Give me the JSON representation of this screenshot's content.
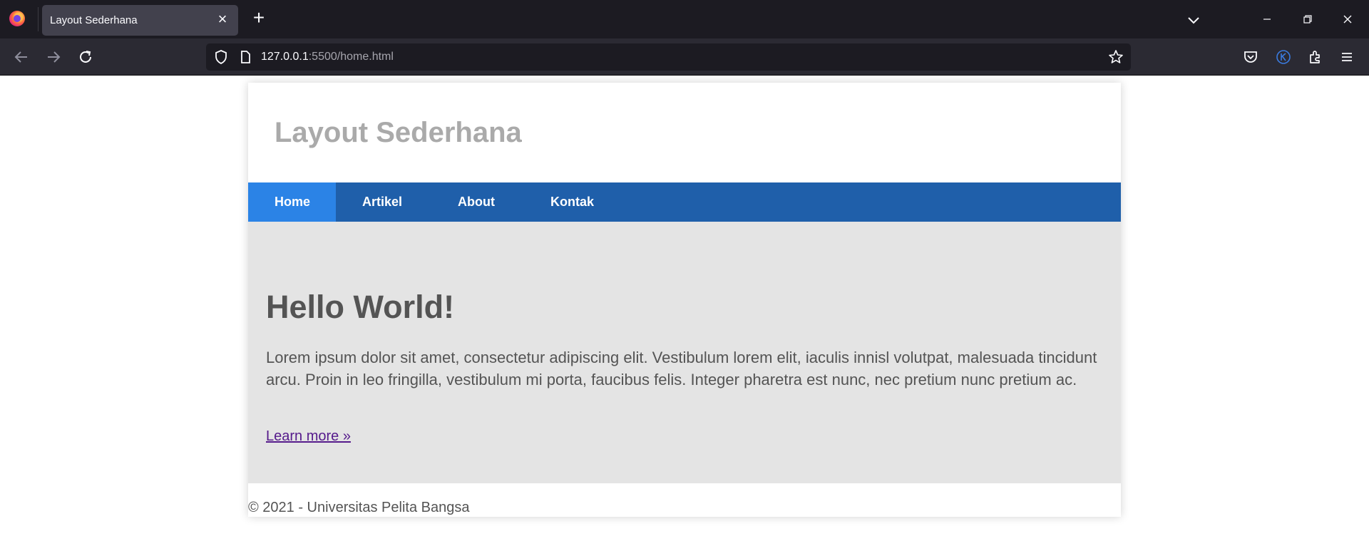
{
  "browser": {
    "tab_title": "Layout Sederhana",
    "url_host": "127.0.0.1",
    "url_rest": ":5500/home.html"
  },
  "page": {
    "site_title": "Layout Sederhana",
    "menu": [
      {
        "label": "Home",
        "active": true
      },
      {
        "label": "Artikel",
        "active": false
      },
      {
        "label": "About",
        "active": false
      },
      {
        "label": "Kontak",
        "active": false
      }
    ],
    "hero": {
      "title": "Hello World!",
      "text": "Lorem ipsum dolor sit amet, consectetur adipiscing elit. Vestibulum lorem elit, iaculis innisl volutpat, malesuada tincidunt arcu. Proin in leo fringilla, vestibulum mi porta, faucibus felis. Integer pharetra est nunc, nec pretium nunc pretium ac.",
      "link": "Learn more »"
    },
    "footer": "© 2021 - Universitas Pelita Bangsa"
  },
  "colors": {
    "menu_bg": "#1f5faa",
    "menu_active": "#2b83e6",
    "hero_bg": "#e4e4e4",
    "title_gray": "#aaaaaa"
  }
}
